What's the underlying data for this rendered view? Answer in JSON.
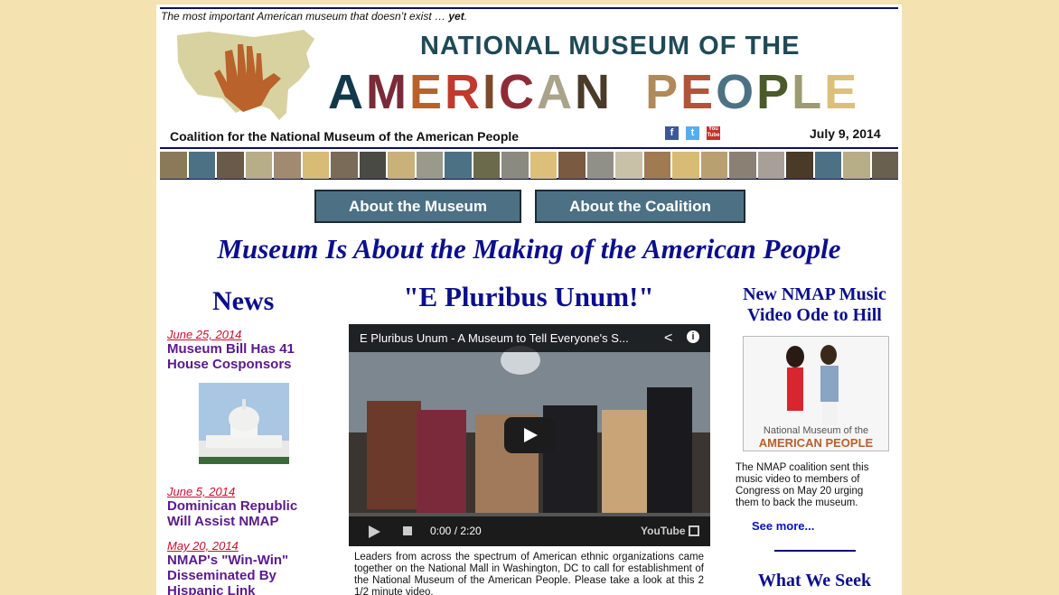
{
  "tagline": {
    "text": "The most important American museum that doesn’t exist … ",
    "emph": "yet",
    "end": "."
  },
  "title": {
    "line1": "NATIONAL MUSEUM OF THE",
    "letters": [
      "A",
      "M",
      "E",
      "R",
      "I",
      "C",
      "A",
      "N",
      " ",
      " ",
      "P",
      "E",
      "O",
      "P",
      "L",
      "E"
    ]
  },
  "colors": {
    "letters": [
      "#12384a",
      "#7a2a38",
      "#b8612c",
      "#c03a2d",
      "#7d4a2b",
      "#8f2b36",
      "#a9a38a",
      "#4a3a28",
      "#ffffff",
      "#ffffff",
      "#b08a5a",
      "#b2543a",
      "#4d7184",
      "#4a5a2a",
      "#9d9a72",
      "#dcc07a"
    ]
  },
  "coalition": "Coalition for the National Museum of the American People",
  "social": {
    "facebook": "f",
    "twitter": "t",
    "youtube": "You Tube"
  },
  "date": "July 9, 2014",
  "nav": {
    "about_museum": "About the Museum",
    "about_coalition": "About the Coalition"
  },
  "headline": "Museum Is About the Making of the American People",
  "news": {
    "heading": "News",
    "items": [
      {
        "date": "June 25, 2014",
        "title": "Museum Bill Has 41 House Cosponsors"
      },
      {
        "date": "June 5, 2014",
        "title": "Dominican Republic Will Assist NMAP"
      },
      {
        "date": "May 20, 2014",
        "title": "NMAP's \"Win-Win\" Disseminated By Hispanic Link"
      }
    ]
  },
  "center": {
    "heading": "\"E Pluribus Unum!\"",
    "video_title": "E Pluribus Unum - A Museum to Tell Everyone's S...",
    "time": "0:00 / 2:20",
    "yt": "YouTube",
    "caption": "Leaders from across the spectrum of American ethnic organizations came together on the National Mall in Washington, DC to call for establishment of the National Museum of the American People. Please take a look at this 2 1/2 minute video."
  },
  "right": {
    "heading": "New NMAP Music Video Ode to Hill",
    "thumb_line1": "National Museum of the",
    "thumb_line2": "AMERICAN PEOPLE",
    "text": "The NMAP coalition sent this music video to members of Congress on May 20 urging them to back the museum.",
    "see_more": "See more...",
    "what": "What We Seek"
  }
}
